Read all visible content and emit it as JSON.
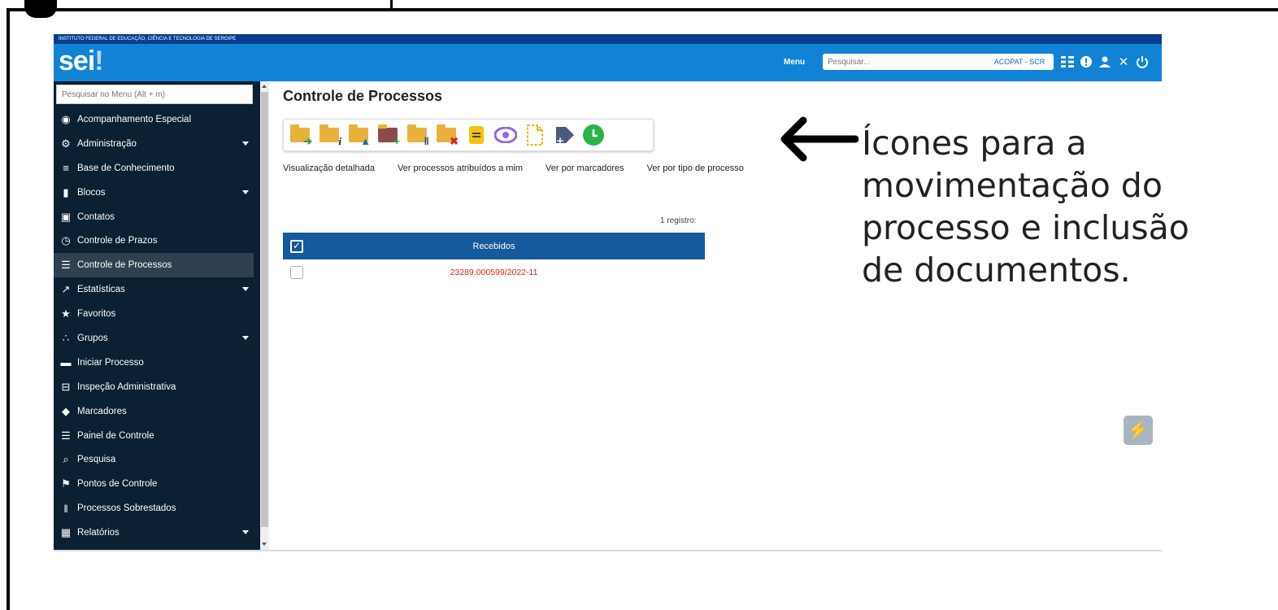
{
  "header": {
    "institution": "INSTITUTO FEDERAL DE EDUCAÇÃO, CIÊNCIA E TECNOLOGIA DE SERGIPE",
    "logo": "sei",
    "logo_bang": "!",
    "menu_label": "Menu",
    "search_placeholder": "Pesquisar...",
    "unit_label": "ACOPAT - SCR",
    "icons": [
      "grid-icon",
      "alert-icon",
      "user-icon",
      "tools-icon",
      "power-icon"
    ]
  },
  "sidebar": {
    "search_placeholder": "Pesquisar no Menu (Alt + m)",
    "items": [
      {
        "label": "Acompanhamento Especial",
        "icon": "eye-icon",
        "has_submenu": false
      },
      {
        "label": "Administração",
        "icon": "gears-icon",
        "has_submenu": true
      },
      {
        "label": "Base de Conhecimento",
        "icon": "database-icon",
        "has_submenu": false
      },
      {
        "label": "Blocos",
        "icon": "books-icon",
        "has_submenu": true
      },
      {
        "label": "Contatos",
        "icon": "contact-card-icon",
        "has_submenu": false
      },
      {
        "label": "Controle de Prazos",
        "icon": "clock-icon",
        "has_submenu": false
      },
      {
        "label": "Controle de Processos",
        "icon": "list-icon",
        "has_submenu": false,
        "active": true
      },
      {
        "label": "Estatísticas",
        "icon": "chart-icon",
        "has_submenu": true
      },
      {
        "label": "Favoritos",
        "icon": "star-icon",
        "has_submenu": false
      },
      {
        "label": "Grupos",
        "icon": "group-icon",
        "has_submenu": true
      },
      {
        "label": "Iniciar Processo",
        "icon": "folder-icon",
        "has_submenu": false
      },
      {
        "label": "Inspeção Administrativa",
        "icon": "inspect-icon",
        "has_submenu": false
      },
      {
        "label": "Marcadores",
        "icon": "tag-icon",
        "has_submenu": false
      },
      {
        "label": "Painel de Controle",
        "icon": "panel-icon",
        "has_submenu": false
      },
      {
        "label": "Pesquisa",
        "icon": "search-icon",
        "has_submenu": false
      },
      {
        "label": "Pontos de Controle",
        "icon": "flag-icon",
        "has_submenu": false
      },
      {
        "label": "Processos Sobrestados",
        "icon": "pause-icon",
        "has_submenu": false
      },
      {
        "label": "Relatórios",
        "icon": "table-icon",
        "has_submenu": true
      }
    ]
  },
  "main": {
    "title": "Controle de Processos",
    "toolbar_icons": [
      "send-process-icon",
      "process-info-icon",
      "assign-process-icon",
      "add-to-block-icon",
      "suspend-process-icon",
      "conclude-process-icon",
      "annotation-icon",
      "view-icon",
      "new-document-icon",
      "add-marker-icon",
      "deadline-clock-icon"
    ],
    "views": [
      "Visualização detalhada",
      "Ver processos atribuídos a mim",
      "Ver por marcadores",
      "Ver por tipo de processo"
    ],
    "record_count": "1 registro:",
    "table": {
      "header": "Recebidos",
      "rows": [
        {
          "process": "23289.000599/2022-11"
        }
      ]
    }
  },
  "annotation": {
    "lines": [
      "Ícones para a",
      "movimentação do",
      "processo e inclusão",
      "de documentos."
    ]
  },
  "colors": {
    "header_blue": "#1283d4",
    "institution_bar": "#0a3d91",
    "sidebar_bg": "#0b2032",
    "table_header": "#155a9c",
    "process_link": "#e02020",
    "folder_yellow": "#e8b23a"
  }
}
